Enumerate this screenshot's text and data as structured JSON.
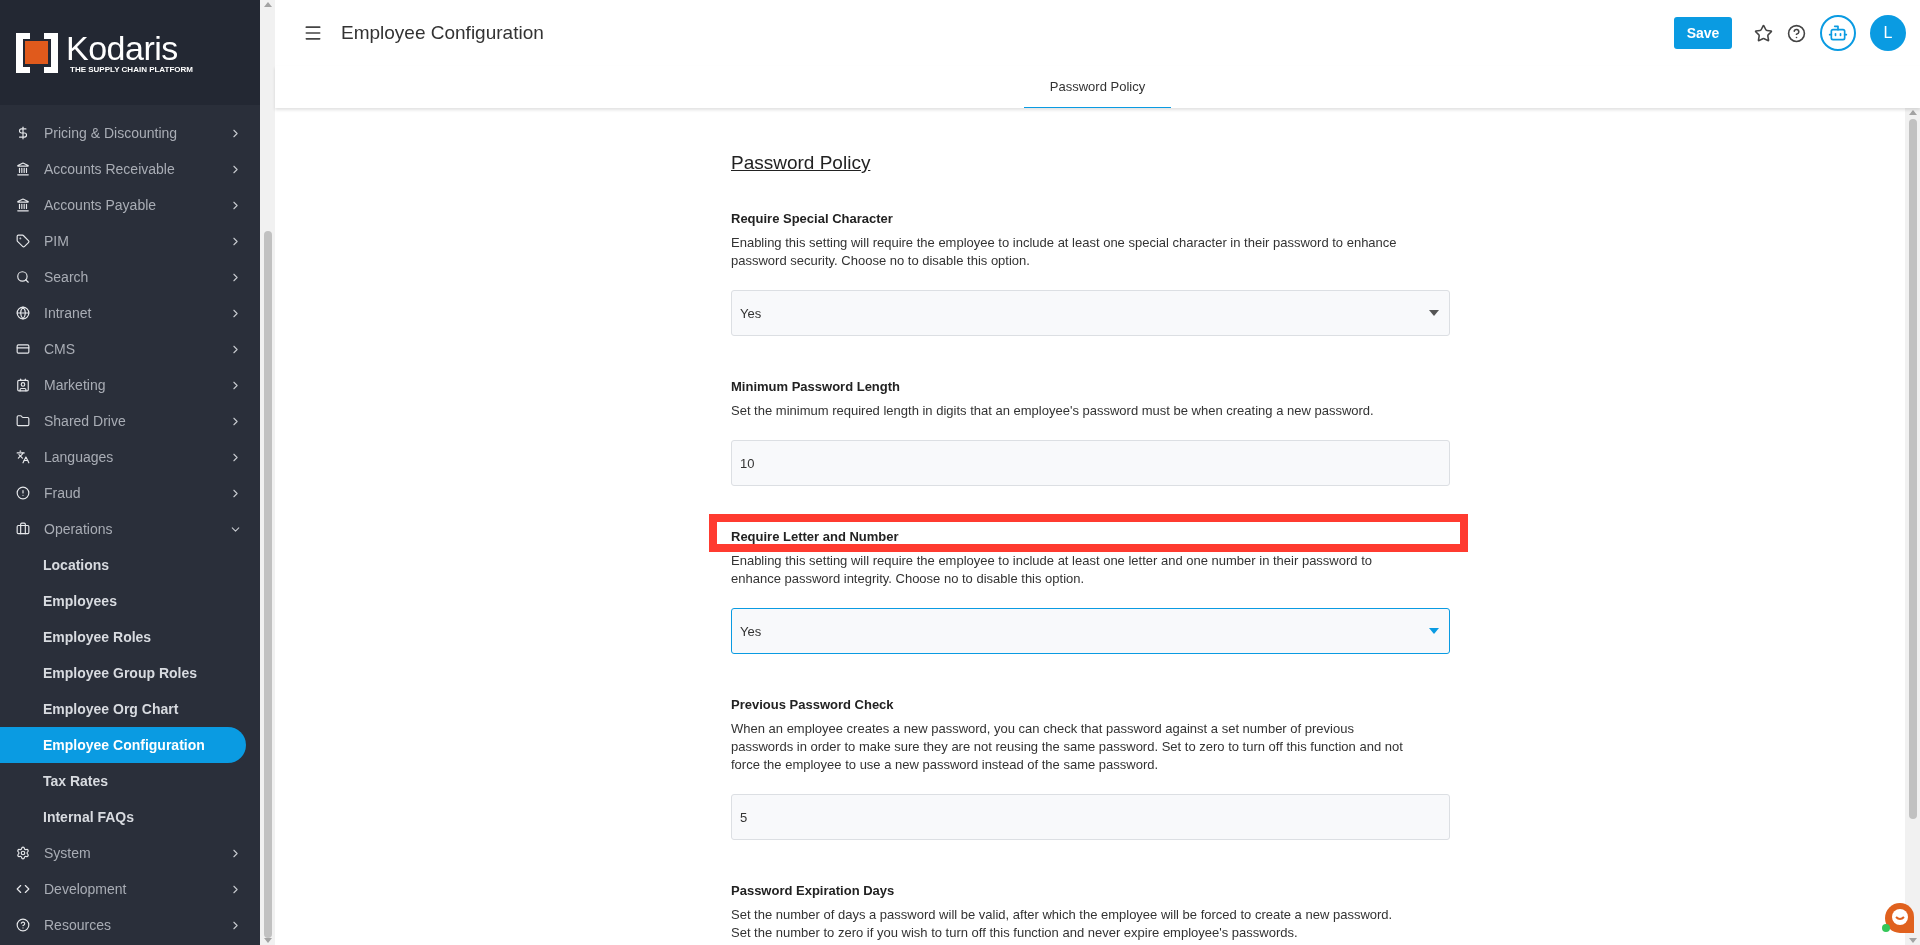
{
  "logo": {
    "name": "Kodaris",
    "tagline": "THE SUPPLY CHAIN PLATFORM"
  },
  "sidebar": {
    "items": [
      {
        "label": "Pricing & Discounting",
        "expanded": false
      },
      {
        "label": "Accounts Receivable",
        "expanded": false
      },
      {
        "label": "Accounts Payable",
        "expanded": false
      },
      {
        "label": "PIM",
        "expanded": false
      },
      {
        "label": "Search",
        "expanded": false
      },
      {
        "label": "Intranet",
        "expanded": false
      },
      {
        "label": "CMS",
        "expanded": false
      },
      {
        "label": "Marketing",
        "expanded": false
      },
      {
        "label": "Shared Drive",
        "expanded": false
      },
      {
        "label": "Languages",
        "expanded": false
      },
      {
        "label": "Fraud",
        "expanded": false
      },
      {
        "label": "Operations",
        "expanded": true,
        "children": [
          {
            "label": "Locations",
            "selected": false
          },
          {
            "label": "Employees",
            "selected": false
          },
          {
            "label": "Employee Roles",
            "selected": false
          },
          {
            "label": "Employee Group Roles",
            "selected": false
          },
          {
            "label": "Employee Org Chart",
            "selected": false
          },
          {
            "label": "Employee Configuration",
            "selected": true
          },
          {
            "label": "Tax Rates",
            "selected": false
          },
          {
            "label": "Internal FAQs",
            "selected": false
          }
        ]
      },
      {
        "label": "System",
        "expanded": false
      },
      {
        "label": "Development",
        "expanded": false
      },
      {
        "label": "Resources",
        "expanded": false
      }
    ]
  },
  "header": {
    "title": "Employee Configuration",
    "save": "Save",
    "avatar": "L"
  },
  "tabs": [
    {
      "label": "Password Policy",
      "selected": true
    }
  ],
  "section": {
    "title": "Password Policy",
    "settings": [
      {
        "label": "Require Special Character",
        "description": "Enabling this setting will require the employee to include at least one special character in their password to enhance password security. Choose no to disable this option.",
        "kind": "select",
        "value": "Yes",
        "focused": false,
        "highlighted": false
      },
      {
        "label": "Minimum Password Length",
        "description": "Set the minimum required length in digits that an employee's password must be when creating a new password.",
        "kind": "input",
        "value": "10",
        "focused": false,
        "highlighted": false
      },
      {
        "label": "Require Letter and Number",
        "description": "Enabling this setting will require the employee to include at least one letter and one number in their password to enhance password integrity. Choose no to disable this option.",
        "kind": "select",
        "value": "Yes",
        "focused": true,
        "highlighted": true
      },
      {
        "label": "Previous Password Check",
        "description": "When an employee creates a new password, you can check that password against a set number of previous passwords in order to make sure they are not reusing the same password. Set to zero to turn off this function and not force the employee to use a new password instead of the same password.",
        "kind": "input",
        "value": "5",
        "focused": false,
        "highlighted": false
      },
      {
        "label": "Password Expiration Days",
        "description": "Set the number of days a password will be valid, after which the employee will be forced to create a new password. Set the number to zero if you wish to turn off this function and never expire employee's passwords.",
        "kind": "text",
        "highlighted": false
      }
    ]
  }
}
